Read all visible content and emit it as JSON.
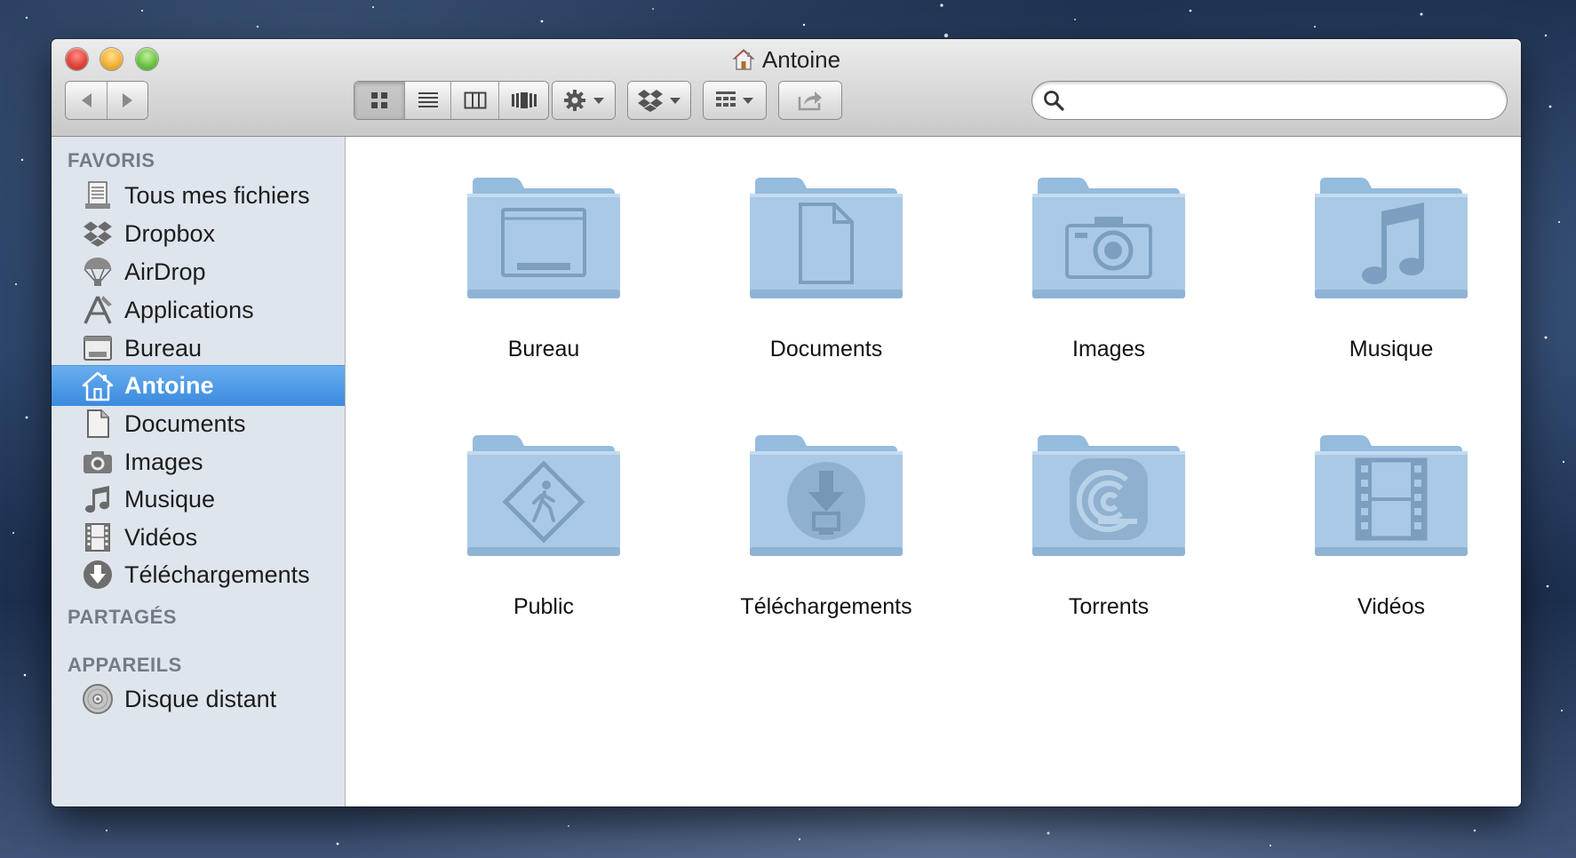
{
  "window": {
    "title": "Antoine"
  },
  "toolbar": {
    "search": {
      "value": "",
      "placeholder": ""
    }
  },
  "sidebar": {
    "favorites_heading": "FAVORIS",
    "favorites": [
      {
        "label": "Tous mes fichiers",
        "icon": "all-files-icon"
      },
      {
        "label": "Dropbox",
        "icon": "dropbox-icon"
      },
      {
        "label": "AirDrop",
        "icon": "airdrop-icon"
      },
      {
        "label": "Applications",
        "icon": "applications-icon"
      },
      {
        "label": "Bureau",
        "icon": "desktop-icon"
      },
      {
        "label": "Antoine",
        "icon": "home-icon",
        "selected": true
      },
      {
        "label": "Documents",
        "icon": "documents-icon"
      },
      {
        "label": "Images",
        "icon": "camera-icon"
      },
      {
        "label": "Musique",
        "icon": "music-note-icon"
      },
      {
        "label": "Vidéos",
        "icon": "film-icon"
      },
      {
        "label": "Téléchargements",
        "icon": "download-icon"
      }
    ],
    "shared_heading": "PARTAGÉS",
    "devices_heading": "APPAREILS",
    "devices": [
      {
        "label": "Disque distant",
        "icon": "disc-icon"
      }
    ]
  },
  "folders": [
    {
      "label": "Bureau",
      "icon": "desktop-icon"
    },
    {
      "label": "Documents",
      "icon": "document-icon"
    },
    {
      "label": "Images",
      "icon": "camera-icon"
    },
    {
      "label": "Musique",
      "icon": "music-note-icon"
    },
    {
      "label": "Public",
      "icon": "pedestrian-sign-icon"
    },
    {
      "label": "Téléchargements",
      "icon": "download-icon"
    },
    {
      "label": "Torrents",
      "icon": "torrent-icon"
    },
    {
      "label": "Vidéos",
      "icon": "film-icon"
    }
  ],
  "colors": {
    "selection": "#3a8ade",
    "folder": "#a9c9e6",
    "sidebar_bg": "#dfe5ec"
  }
}
